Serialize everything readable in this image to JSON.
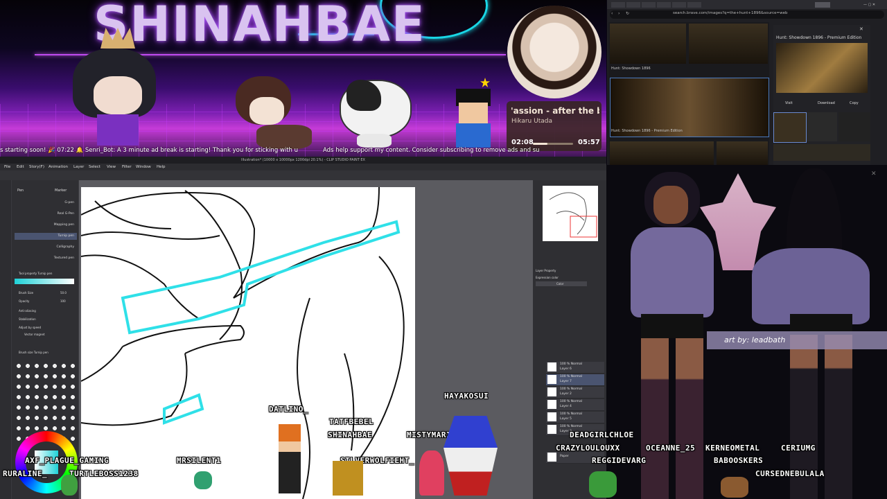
{
  "stream": {
    "title": "SHINAHBAE",
    "ticker": "s starting soon!  🎉  07:22 🔔 Senri_Bot: A 3 minute ad break is starting! Thank you for sticking with u",
    "ticker2": "Ads help support my content. Consider subscribing to remove ads and su"
  },
  "music": {
    "song": "'assion - after the bc",
    "artist": "Hikaru Utada",
    "elapsed": "02:08",
    "total": "05:57",
    "progress": 0.36
  },
  "browser": {
    "url": "search.brave.com/images?q=the+hunt+1896&source=web",
    "result1": "Hunt: Showdown 1896",
    "result2": "Hunt: Showdown 1896 - Premium Edition",
    "preview_title": "Hunt: Showdown 1896 - Premium Edition",
    "visit": "Visit",
    "download": "Download",
    "copy": "Copy"
  },
  "csp": {
    "window_title": "Illustration* (10000 x 10000px 1200dpi 20.1%) - CLIP STUDIO PAINT EX",
    "menu": [
      "File",
      "Edit",
      "Story(F)",
      "Animation",
      "Layer",
      "Select",
      "View",
      "Filter",
      "Window",
      "Help"
    ],
    "subtool_tabs": [
      "Pen",
      "Marker"
    ],
    "brushes": [
      "G-pen",
      "Real G-Pen",
      "Mapping pen",
      "Turnip pen",
      "Calligraphy",
      "Textured pen"
    ],
    "tool_property": "Tool property  Turnip pen",
    "brush_size_label": "Brush Size",
    "brush_size": "50.0",
    "opacity_label": "Opacity",
    "opacity": "100",
    "antialias_label": "Anti-aliasing",
    "stabilization_label": "Stabilization",
    "adjust_label": "Adjust by speed",
    "vector_label": "Vector magnet",
    "brush_sizes_header": "Brush size  Turnip pen",
    "expression_label": "Expression color",
    "expression_value": "Color",
    "layer_property": "Layer Property",
    "layers": [
      {
        "mode": "100 % Normal",
        "name": "Layer 6"
      },
      {
        "mode": "100 % Normal",
        "name": "Layer 7"
      },
      {
        "mode": "100 % Normal",
        "name": "Layer 2"
      },
      {
        "mode": "100 % Normal",
        "name": "Layer 4"
      },
      {
        "mode": "100 % Normal",
        "name": "Layer 5"
      },
      {
        "mode": "100 % Normal",
        "name": "Layer 3"
      },
      {
        "mode": "",
        "name": "Paper"
      }
    ]
  },
  "vtuber": {
    "credit": "art by: leadbath"
  },
  "chatters": [
    "DATLINO_",
    "TATFBEBEL",
    "SHINAHBAE",
    "HAYAKOSUI",
    "MISTYMARINA",
    "DEADGIRLCHLOE",
    "AXF_PLAGUE_GAMING",
    "MRSILENT1",
    "SILVERWOLFIEHT_",
    "CRAZYLOULOUXX",
    "OCEANNE_25",
    "KERNEOMETAL",
    "CERIUMG",
    "REGGIDEVARG",
    "BABOOSKERS",
    "CURSEDNEBULALA",
    "RURALINE_",
    "TURTLEBOSS1238"
  ],
  "colors": {
    "accent": "#19d7e6",
    "banner": "#7a1fb0"
  }
}
